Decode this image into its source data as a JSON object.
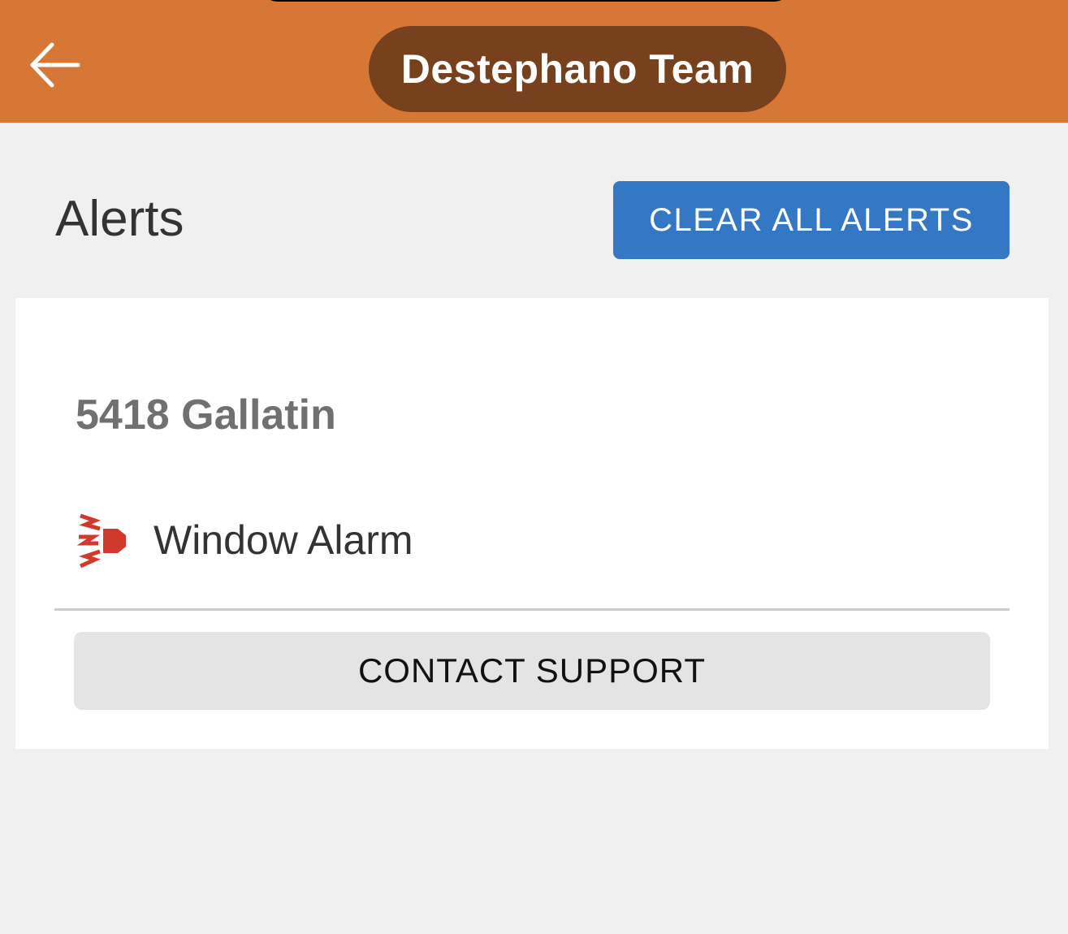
{
  "header": {
    "title": "Destephano Team",
    "back_icon": "arrow-left-icon",
    "background_color": "#d67736",
    "title_pill_color": "#76411c"
  },
  "alerts_section": {
    "heading": "Alerts",
    "clear_button_label": "CLEAR ALL ALERTS",
    "clear_button_color": "#3477c5"
  },
  "alert_card": {
    "location": "5418 Gallatin",
    "alerts": [
      {
        "icon": "siren-alarm-icon",
        "icon_color": "#d0392b",
        "label": "Window Alarm"
      }
    ],
    "support_button_label": "CONTACT SUPPORT"
  }
}
